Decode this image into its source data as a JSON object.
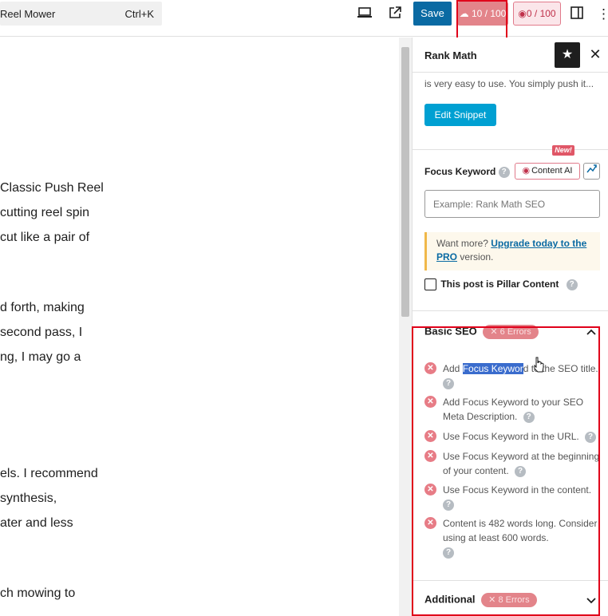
{
  "toolbar": {
    "doc_title": "Reel Mower",
    "shortcut": "Ctrl+K",
    "save_label": "Save",
    "seo_score": "10 / 100",
    "ai_score": "0 / 100"
  },
  "editor": {
    "lines": [
      "Classic Push Reel",
      "cutting reel spin",
      "cut like a pair of",
      "d forth, making",
      "second pass, I",
      "ng, I may go a",
      "els. I recommend",
      "synthesis,",
      "ater and less",
      "ch mowing to"
    ]
  },
  "sidebar": {
    "title": "Rank Math",
    "snippet_description": "is very easy to use. You simply push it...",
    "edit_snippet_label": "Edit Snippet",
    "focus_keyword_label": "Focus Keyword",
    "new_badge": "New!",
    "content_ai_label": "Content AI",
    "focus_keyword_placeholder": "Example: Rank Math SEO",
    "upgrade_prefix": "Want more?",
    "upgrade_link": "Upgrade today to the PRO",
    "upgrade_suffix": "version.",
    "pillar_label": "This post is Pillar Content",
    "basic_seo": {
      "title": "Basic SEO",
      "badge": "6 Errors",
      "items": [
        {
          "pre": "Add ",
          "highlight": "Focus Keywor",
          "post": "d to the SEO title."
        },
        {
          "text": "Add Focus Keyword to your SEO Meta Description."
        },
        {
          "text": "Use Focus Keyword in the URL."
        },
        {
          "text": "Use Focus Keyword at the beginning of your content."
        },
        {
          "text": "Use Focus Keyword in the content."
        },
        {
          "text": "Content is 482 words long. Consider using at least 600 words."
        }
      ]
    },
    "additional": {
      "title": "Additional",
      "badge": "8 Errors"
    }
  },
  "colors": {
    "accent": "#0a6aa3",
    "score_bad": "#e3848a",
    "annotation": "#e0001a",
    "edit_snippet": "#00a0d2"
  }
}
